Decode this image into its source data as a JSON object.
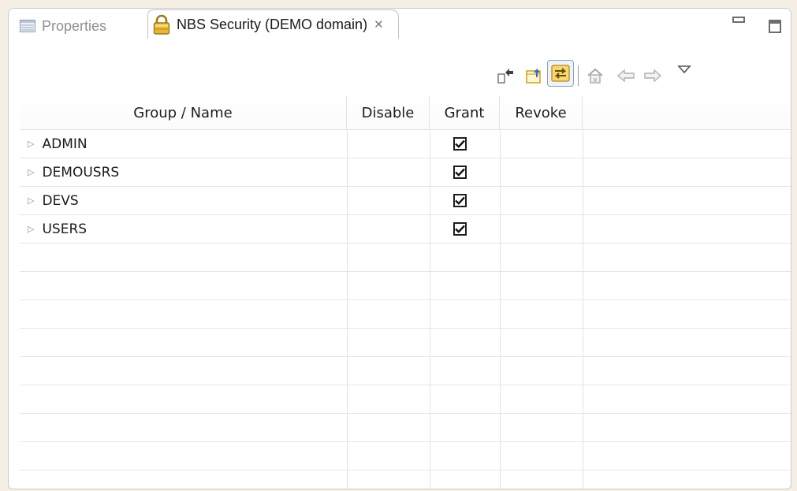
{
  "tabs": {
    "properties_label": "Properties",
    "security_label": "NBS Security (DEMO domain)"
  },
  "colors": {
    "accent": "#c89a1a",
    "active_link_bg": "#eef3f8"
  },
  "toolbar": {
    "icons": [
      "collapse-icon",
      "export-icon",
      "link-with-editor-icon",
      "home-icon",
      "back-arrow-icon",
      "forward-arrow-icon",
      "view-menu-icon"
    ]
  },
  "table": {
    "columns": [
      "Group / Name",
      "Disable",
      "Grant",
      "Revoke"
    ],
    "rows": [
      {
        "name": "ADMIN",
        "disable": false,
        "grant": true,
        "revoke": false
      },
      {
        "name": "DEMOUSRS",
        "disable": false,
        "grant": true,
        "revoke": false
      },
      {
        "name": "DEVS",
        "disable": false,
        "grant": true,
        "revoke": false
      },
      {
        "name": "USERS",
        "disable": false,
        "grant": true,
        "revoke": false
      }
    ]
  }
}
